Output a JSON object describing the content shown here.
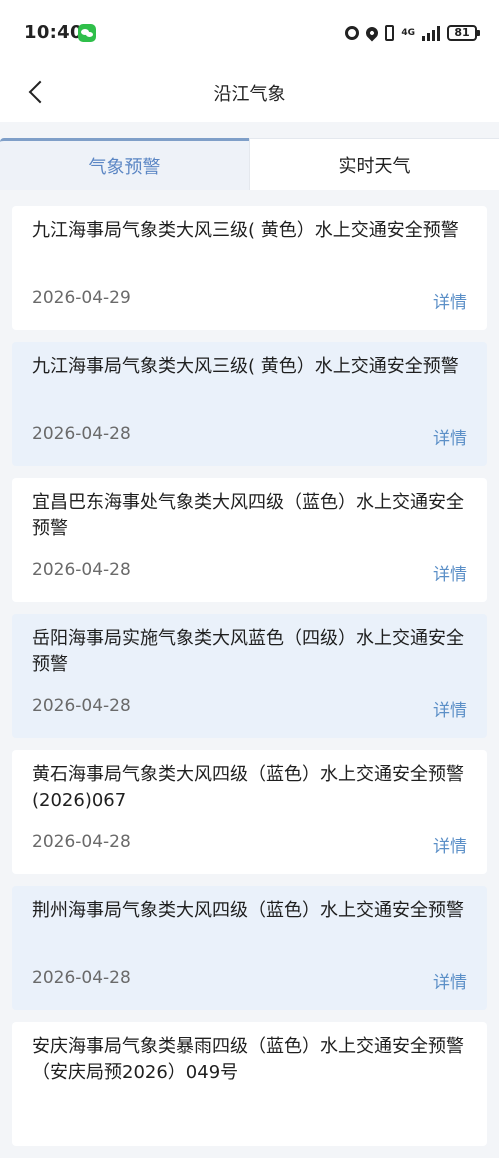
{
  "status_bar": {
    "time": "10:40",
    "network": "4G",
    "battery": "81"
  },
  "nav": {
    "title": "沿江气象"
  },
  "tabs": [
    {
      "label": "气象预警",
      "active": true
    },
    {
      "label": "实时天气",
      "active": false
    }
  ],
  "detail_label": "详情",
  "alerts": [
    {
      "title": "九江海事局气象类大风三级( 黄色）水上交通安全预警",
      "date": "2026-04-29"
    },
    {
      "title": "九江海事局气象类大风三级( 黄色）水上交通安全预警",
      "date": "2026-04-28"
    },
    {
      "title": "宜昌巴东海事处气象类大风四级（蓝色）水上交通安全预警",
      "date": "2026-04-28"
    },
    {
      "title": "岳阳海事局实施气象类大风蓝色（四级）水上交通安全预警",
      "date": "2026-04-28"
    },
    {
      "title": "黄石海事局气象类大风四级（蓝色）水上交通安全预警 (2026)067",
      "date": "2026-04-28"
    },
    {
      "title": "荆州海事局气象类大风四级（蓝色）水上交通安全预警",
      "date": "2026-04-28"
    },
    {
      "title": "安庆海事局气象类暴雨四级（蓝色）水上交通安全预警（安庆局预2026）049号",
      "date": ""
    }
  ],
  "colors": {
    "accent": "#5b86c4",
    "detail_link": "#5b8fc7",
    "alt_card_bg": "#eaf1fa"
  }
}
